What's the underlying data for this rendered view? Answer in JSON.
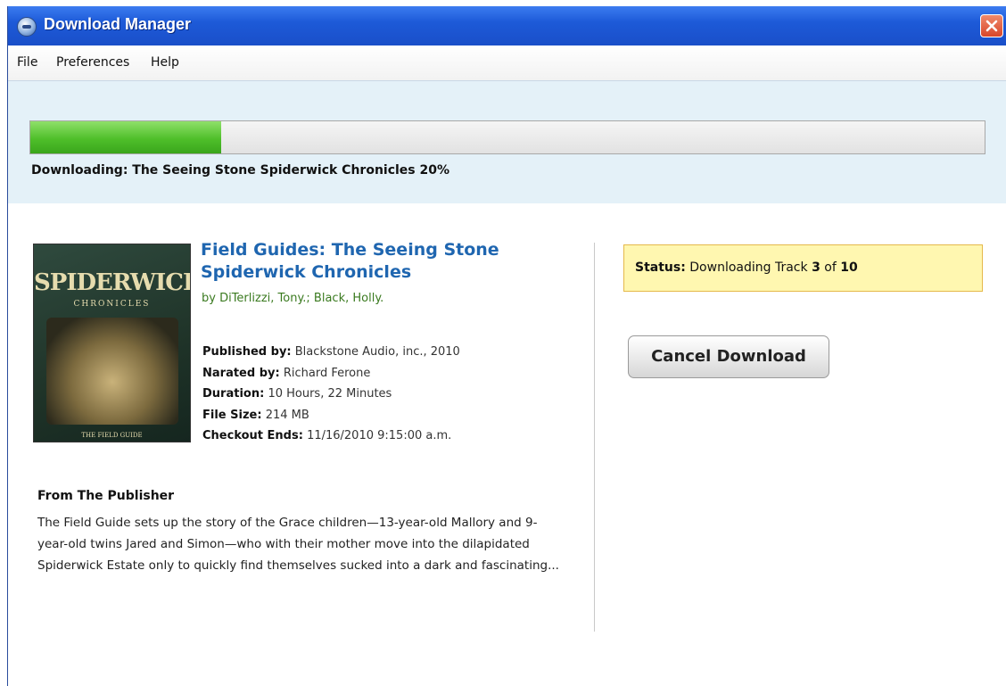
{
  "window": {
    "title": "Download Manager"
  },
  "menu": {
    "items": [
      "File",
      "Preferences",
      "Help"
    ]
  },
  "progress": {
    "percent": 20,
    "label": "Downloading: The Seeing Stone Spiderwick Chronicles  20%"
  },
  "cover": {
    "title": "SPIDERWICK",
    "subtitle": "CHRONICLES",
    "footer": "THE FIELD GUIDE"
  },
  "book": {
    "title": "Field Guides: The Seeing Stone Spiderwick Chronicles",
    "authors": "by DiTerlizzi, Tony.; Black, Holly.",
    "details": [
      {
        "label": "Published by:",
        "value": "Blackstone Audio, inc., 2010"
      },
      {
        "label": "Narated by:",
        "value": "Richard Ferone"
      },
      {
        "label": "Duration:",
        "value": "10 Hours, 22 Minutes"
      },
      {
        "label": "File Size:",
        "value": "214 MB"
      },
      {
        "label": "Checkout Ends:",
        "value": "11/16/2010  9:15:00 a.m."
      }
    ]
  },
  "publisher": {
    "heading": "From The Publisher",
    "description": "The Field Guide sets up the story of the Grace children—13-year-old Mallory and 9-year-old twins Jared and Simon—who with their mother move into the dilapidated Spiderwick Estate only to quickly find themselves sucked into a dark and fascinating..."
  },
  "status": {
    "label": "Status:",
    "prefix": "Downloading Track",
    "current": "3",
    "of": "of",
    "total": "10"
  },
  "actions": {
    "cancel": "Cancel Download"
  },
  "colors": {
    "titlebar": "#1d5ad8",
    "progress_fill": "#4fbf2a",
    "link": "#1f66b0",
    "author": "#3a7a1f",
    "status_bg": "#fff7b0"
  }
}
